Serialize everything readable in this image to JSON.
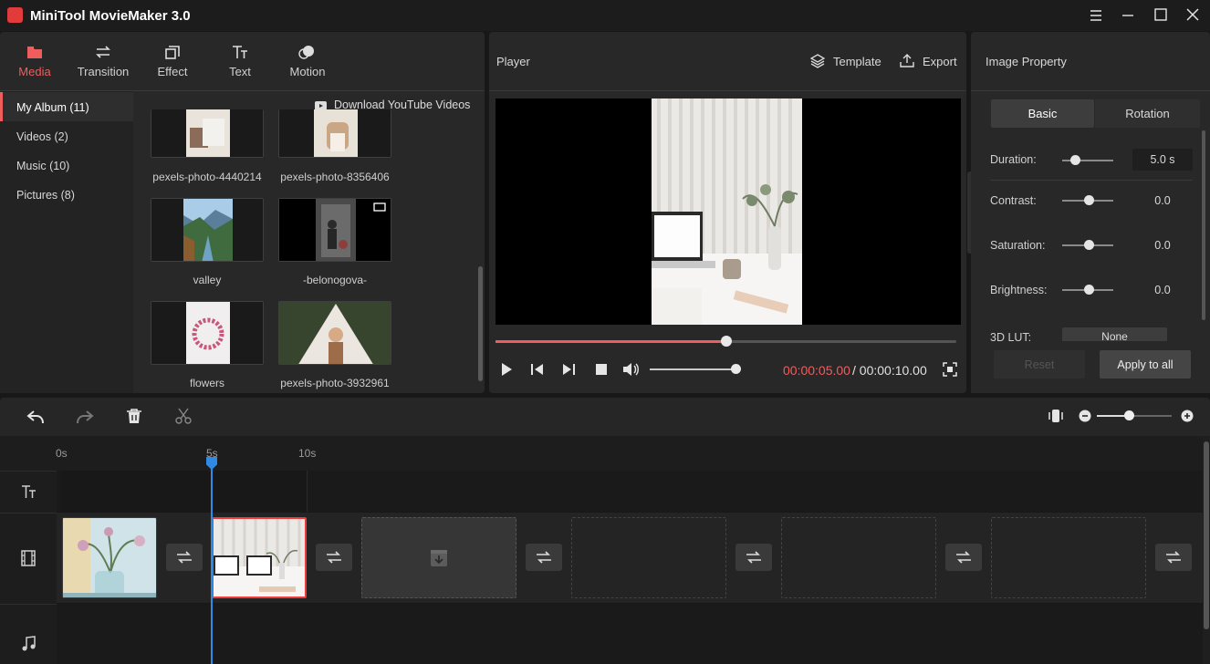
{
  "app": {
    "title": "MiniTool MovieMaker 3.0"
  },
  "toolbar": [
    {
      "label": "Media",
      "icon": "folder-icon"
    },
    {
      "label": "Transition",
      "icon": "transition-icon"
    },
    {
      "label": "Effect",
      "icon": "effect-icon"
    },
    {
      "label": "Text",
      "icon": "text-icon"
    },
    {
      "label": "Motion",
      "icon": "motion-icon"
    }
  ],
  "album": [
    {
      "label": "My Album (11)"
    },
    {
      "label": "Videos (2)"
    },
    {
      "label": "Music (10)"
    },
    {
      "label": "Pictures (8)"
    }
  ],
  "media": {
    "download_label": "Download YouTube Videos",
    "items": [
      {
        "name": "pexels-photo-4440214"
      },
      {
        "name": "pexels-photo-8356406"
      },
      {
        "name": "valley"
      },
      {
        "name": "-belonogova-"
      },
      {
        "name": "flowers"
      },
      {
        "name": "pexels-photo-3932961"
      }
    ]
  },
  "player": {
    "label": "Player",
    "template_label": "Template",
    "export_label": "Export",
    "time_current": "00:00:05.00",
    "time_total": "/ 00:00:10.00",
    "progress": 0.5,
    "volume": 1.0
  },
  "property": {
    "title": "Image Property",
    "tabs": [
      "Basic",
      "Rotation"
    ],
    "duration_label": "Duration:",
    "duration_value": "5.0 s",
    "contrast_label": "Contrast:",
    "contrast_value": "0.0",
    "saturation_label": "Saturation:",
    "saturation_value": "0.0",
    "brightness_label": "Brightness:",
    "brightness_value": "0.0",
    "lut_label": "3D LUT:",
    "lut_value": "None",
    "reset_label": "Reset",
    "apply_label": "Apply to all"
  },
  "timeline": {
    "ticks": [
      "0s",
      "5s",
      "10s"
    ]
  },
  "colors": {
    "accent": "#ef5d5d",
    "playhead": "#2f8ae6"
  }
}
